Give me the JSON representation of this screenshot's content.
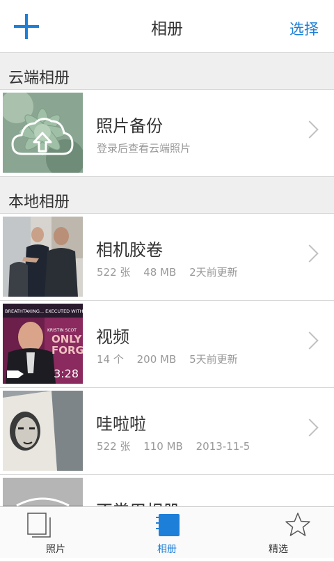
{
  "nav": {
    "title": "相册",
    "select_label": "选择"
  },
  "sections": [
    {
      "title": "云端相册"
    },
    {
      "title": "本地相册"
    }
  ],
  "cloud_row": {
    "title": "照片备份",
    "subtitle": "登录后查看云端照片"
  },
  "local_rows": [
    {
      "title": "相机胶卷",
      "count": "522 张",
      "size": "48 MB",
      "updated": "2天前更新"
    },
    {
      "title": "视频",
      "count": "14 个",
      "size": "200 MB",
      "updated": "5天前更新",
      "duration": "3:28",
      "poster_text": {
        "top": "BREATHTAKING... EXECUTED WITH PURE FORM",
        "name": "KRISTIN SCOT",
        "big1": "ONLY",
        "big2": "FORGI"
      }
    },
    {
      "title": "哇啦啦",
      "count": "522 张",
      "size": "110 MB",
      "updated": "2013-11-5"
    },
    {
      "title": "不常用相册"
    }
  ],
  "tabbar": {
    "tabs": [
      {
        "label": "照片"
      },
      {
        "label": "相册"
      },
      {
        "label": "精选"
      }
    ]
  },
  "colors": {
    "accent": "#1e7fd8",
    "section_bg": "#efefef",
    "subtext": "#999999"
  }
}
